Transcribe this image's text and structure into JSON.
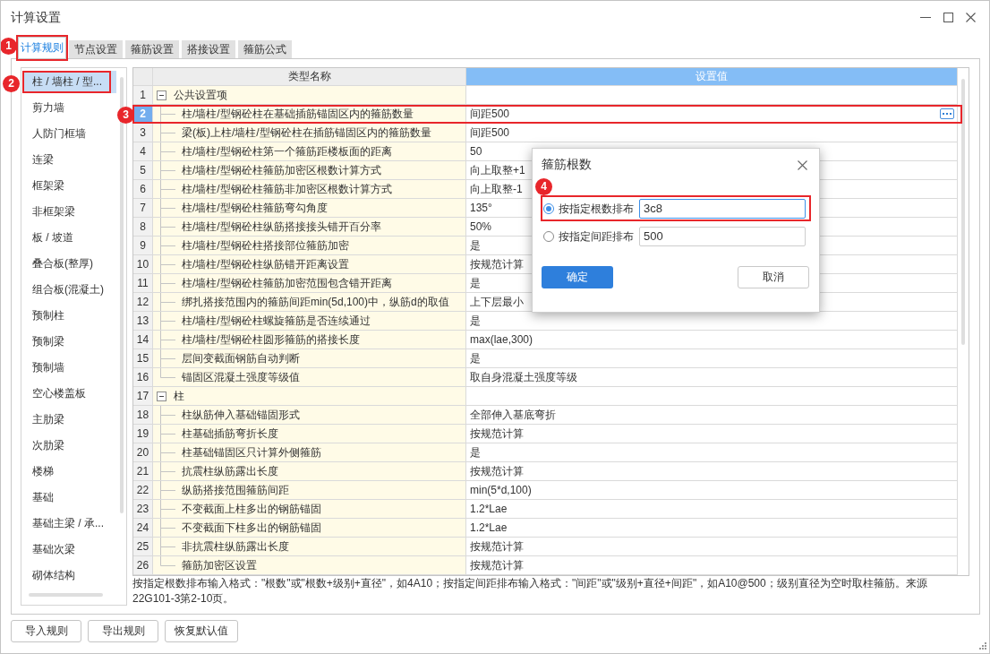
{
  "window": {
    "title": "计算设置"
  },
  "tabs": [
    {
      "label": "计算规则",
      "selected": true,
      "callout": "1"
    },
    {
      "label": "节点设置",
      "selected": false
    },
    {
      "label": "箍筋设置",
      "selected": false
    },
    {
      "label": "搭接设置",
      "selected": false
    },
    {
      "label": "箍筋公式",
      "selected": false
    }
  ],
  "sidebar": {
    "items": [
      {
        "label": "柱 / 墙柱 / 型...",
        "selected": true,
        "callout": "2"
      },
      {
        "label": "剪力墙",
        "selected": false
      },
      {
        "label": "人防门框墙",
        "selected": false
      },
      {
        "label": "连梁",
        "selected": false
      },
      {
        "label": "框架梁",
        "selected": false
      },
      {
        "label": "非框架梁",
        "selected": false
      },
      {
        "label": "板 / 坡道",
        "selected": false
      },
      {
        "label": "叠合板(整厚)",
        "selected": false
      },
      {
        "label": "组合板(混凝土)",
        "selected": false
      },
      {
        "label": "预制柱",
        "selected": false
      },
      {
        "label": "预制梁",
        "selected": false
      },
      {
        "label": "预制墙",
        "selected": false
      },
      {
        "label": "空心楼盖板",
        "selected": false
      },
      {
        "label": "主肋梁",
        "selected": false
      },
      {
        "label": "次肋梁",
        "selected": false
      },
      {
        "label": "楼梯",
        "selected": false
      },
      {
        "label": "基础",
        "selected": false
      },
      {
        "label": "基础主梁 / 承...",
        "selected": false
      },
      {
        "label": "基础次梁",
        "selected": false
      },
      {
        "label": "砌体结构",
        "selected": false
      }
    ]
  },
  "table": {
    "columns": [
      "类型名称",
      "设置值"
    ],
    "rows": [
      {
        "number": "1",
        "name": "公共设置项",
        "expanded": true,
        "selected": false,
        "children": [
          {
            "number": "2",
            "name": "柱/墙柱/型钢砼柱在基础插筋锚固区内的箍筋数量",
            "value": "间距500",
            "selected": true,
            "callout": "3"
          },
          {
            "number": "3",
            "name": "梁(板)上柱/墙柱/型钢砼柱在插筋锚固区内的箍筋数量",
            "value": "间距500",
            "selected": false
          },
          {
            "number": "4",
            "name": "柱/墙柱/型钢砼柱第一个箍筋距楼板面的距离",
            "value": "50",
            "selected": false
          },
          {
            "number": "5",
            "name": "柱/墙柱/型钢砼柱箍筋加密区根数计算方式",
            "value": "向上取整+1",
            "selected": false
          },
          {
            "number": "6",
            "name": "柱/墙柱/型钢砼柱箍筋非加密区根数计算方式",
            "value": "向上取整-1",
            "selected": false
          },
          {
            "number": "7",
            "name": "柱/墙柱/型钢砼柱箍筋弯勾角度",
            "value": "135°",
            "selected": false
          },
          {
            "number": "8",
            "name": "柱/墙柱/型钢砼柱纵筋搭接接头错开百分率",
            "value": "50%",
            "selected": false
          },
          {
            "number": "9",
            "name": "柱/墙柱/型钢砼柱搭接部位箍筋加密",
            "value": "是",
            "selected": false
          },
          {
            "number": "10",
            "name": "柱/墙柱/型钢砼柱纵筋错开距离设置",
            "value": "按规范计算",
            "selected": false
          },
          {
            "number": "11",
            "name": "柱/墙柱/型钢砼柱箍筋加密范围包含错开距离",
            "value": "是",
            "selected": false
          },
          {
            "number": "12",
            "name": "绑扎搭接范围内的箍筋间距min(5d,100)中，纵筋d的取值",
            "value": "上下层最小",
            "selected": false
          },
          {
            "number": "13",
            "name": "柱/墙柱/型钢砼柱螺旋箍筋是否连续通过",
            "value": "是",
            "selected": false
          },
          {
            "number": "14",
            "name": "柱/墙柱/型钢砼柱圆形箍筋的搭接长度",
            "value": "max(lae,300)",
            "selected": false
          },
          {
            "number": "15",
            "name": "层间变截面钢筋自动判断",
            "value": "是",
            "selected": false
          },
          {
            "number": "16",
            "name": "锚固区混凝土强度等级值",
            "value": "取自身混凝土强度等级",
            "selected": false
          }
        ]
      },
      {
        "number": "17",
        "name": "柱",
        "expanded": true,
        "selected": false,
        "children": [
          {
            "number": "18",
            "name": "柱纵筋伸入基础锚固形式",
            "value": "全部伸入基底弯折",
            "selected": false
          },
          {
            "number": "19",
            "name": "柱基础插筋弯折长度",
            "value": "按规范计算",
            "selected": false
          },
          {
            "number": "20",
            "name": "柱基础锚固区只计算外侧箍筋",
            "value": "是",
            "selected": false
          },
          {
            "number": "21",
            "name": "抗震柱纵筋露出长度",
            "value": "按规范计算",
            "selected": false
          },
          {
            "number": "22",
            "name": "纵筋搭接范围箍筋间距",
            "value": "min(5*d,100)",
            "selected": false
          },
          {
            "number": "23",
            "name": "不变截面上柱多出的钢筋锚固",
            "value": "1.2*Lae",
            "selected": false
          },
          {
            "number": "24",
            "name": "不变截面下柱多出的钢筋锚固",
            "value": "1.2*Lae",
            "selected": false
          },
          {
            "number": "25",
            "name": "非抗震柱纵筋露出长度",
            "value": "按规范计算",
            "selected": false
          },
          {
            "number": "26",
            "name": "箍筋加密区设置",
            "value": "按规范计算",
            "selected": false
          }
        ]
      }
    ]
  },
  "note": "按指定根数排布输入格式：\"根数\"或\"根数+级别+直径\"，如4A10；按指定间距排布输入格式：\"间距\"或\"级别+直径+间距\"，如A10@500；级别直径为空时取柱箍筋。来源22G101-3第2-10页。",
  "footer_buttons": [
    "导入规则",
    "导出规则",
    "恢复默认值"
  ],
  "dialog": {
    "title": "箍筋根数",
    "options": [
      {
        "label": "按指定根数排布",
        "selected": true,
        "value": "3c8",
        "callout": "4"
      },
      {
        "label": "按指定间距排布",
        "selected": false,
        "value": "500"
      }
    ],
    "buttons": [
      {
        "label": "确定",
        "kind": "primary"
      },
      {
        "label": "取消",
        "kind": "secondary"
      }
    ]
  }
}
